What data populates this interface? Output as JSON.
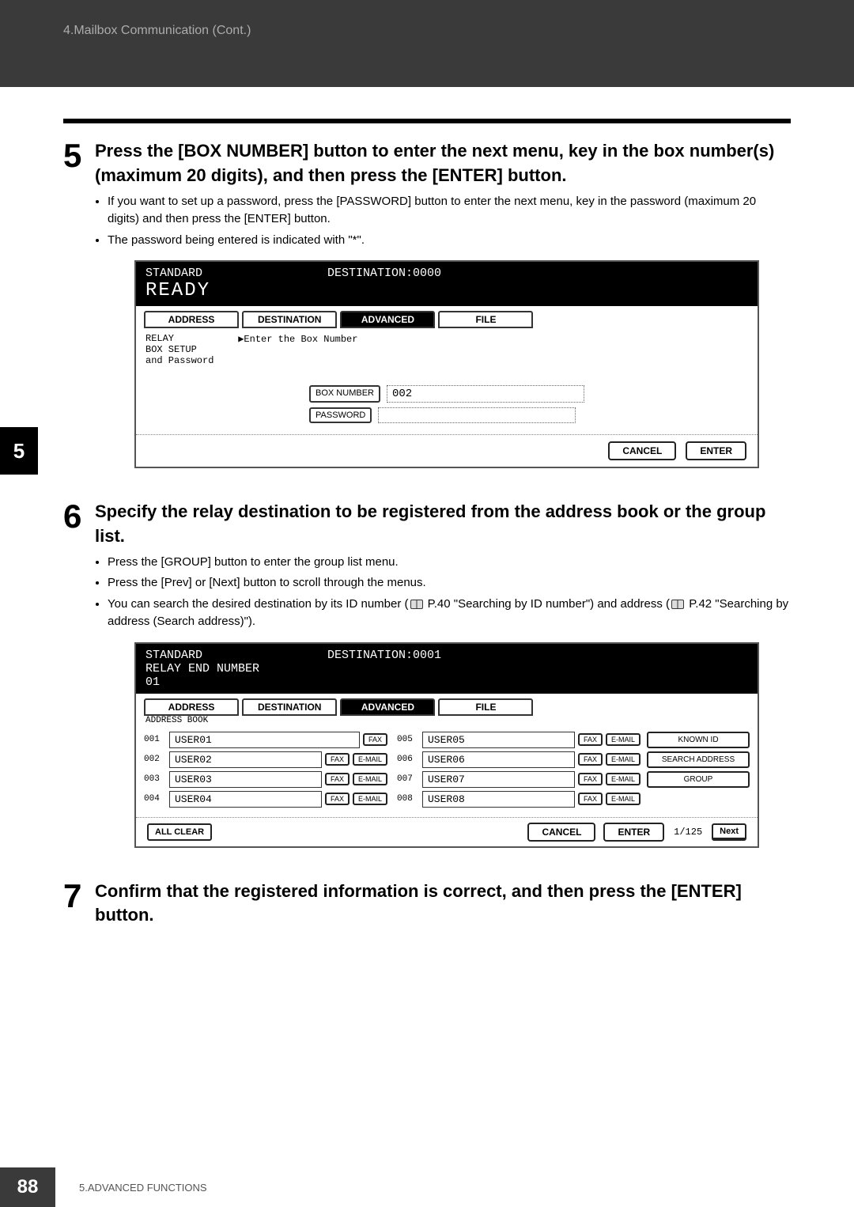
{
  "header": {
    "crumb": "4.Mailbox Communication (Cont.)"
  },
  "side_tab": "5",
  "steps": {
    "five": {
      "num": "5",
      "heading": "Press the [BOX NUMBER] button to enter the next menu, key in the box number(s) (maximum 20 digits), and then press the [ENTER] button.",
      "bullets": [
        "If you want to set up a password, press the [PASSWORD] button to enter the next menu, key in the password (maximum 20 digits) and then press the [ENTER] button.",
        "The password being entered is indicated with \"*\"."
      ]
    },
    "six": {
      "num": "6",
      "heading": "Specify the relay destination to be registered from the address book or the group list.",
      "bullets": [
        "Press the [GROUP] button to enter the group list menu.",
        "Press the [Prev] or [Next] button to scroll through the menus.",
        "You can search the desired destination by its ID number (    P.40 \"Searching by ID number\") and address (    P.42 \"Searching by address (Search address)\")."
      ]
    },
    "seven": {
      "num": "7",
      "heading": "Confirm that the registered information is correct, and then press the [ENTER] button."
    }
  },
  "screen1": {
    "standard": "STANDARD",
    "dest": "DESTINATION:0000",
    "ready": "READY",
    "tabs": {
      "address": "ADDRESS",
      "destination": "DESTINATION",
      "advanced": "ADVANCED",
      "file": "FILE"
    },
    "relay_label": "RELAY\nBOX SETUP",
    "hint": "▶Enter the Box Number\n and Password",
    "box_number_btn": "BOX NUMBER",
    "box_number_val": "002",
    "password_btn": "PASSWORD",
    "cancel": "CANCEL",
    "enter": "ENTER"
  },
  "screen2": {
    "standard": "STANDARD",
    "dest": "DESTINATION:0001",
    "line2": "RELAY END NUMBER",
    "line3": "01",
    "tabs": {
      "address": "ADDRESS",
      "destination": "DESTINATION",
      "advanced": "ADVANCED",
      "file": "FILE"
    },
    "sublabel": "ADDRESS BOOK",
    "rows_left": [
      {
        "id": "001",
        "name": "USER01",
        "fax": "FAX"
      },
      {
        "id": "002",
        "name": "USER02",
        "fax": "FAX",
        "email": "E-MAIL"
      },
      {
        "id": "003",
        "name": "USER03",
        "fax": "FAX",
        "email": "E-MAIL"
      },
      {
        "id": "004",
        "name": "USER04",
        "fax": "FAX",
        "email": "E-MAIL"
      }
    ],
    "rows_right": [
      {
        "id": "005",
        "name": "USER05",
        "fax": "FAX",
        "email": "E-MAIL"
      },
      {
        "id": "006",
        "name": "USER06",
        "fax": "FAX",
        "email": "E-MAIL"
      },
      {
        "id": "007",
        "name": "USER07",
        "fax": "FAX",
        "email": "E-MAIL"
      },
      {
        "id": "008",
        "name": "USER08",
        "fax": "FAX",
        "email": "E-MAIL"
      }
    ],
    "side": {
      "known_id": "KNOWN ID",
      "search_address": "SEARCH ADDRESS",
      "group": "GROUP"
    },
    "all_clear": "ALL CLEAR",
    "cancel": "CANCEL",
    "enter": "ENTER",
    "page": "1/125",
    "next": "Next"
  },
  "footer": {
    "page": "88",
    "chapter": "5.ADVANCED FUNCTIONS"
  }
}
